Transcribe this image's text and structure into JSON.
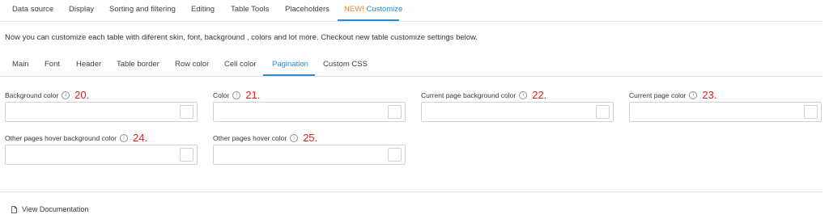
{
  "top_tabs": {
    "data_source": "Data source",
    "display": "Display",
    "sorting": "Sorting and filtering",
    "editing": "Editing",
    "table_tools": "Table Tools",
    "placeholders": "Placeholders",
    "customize_new": "NEW!",
    "customize": "Customize"
  },
  "intro_text": "Now you can customize each table with diferent skin, font, background , colors and lot more. Checkout new table customize settings below.",
  "sub_tabs": {
    "main": "Main",
    "font": "Font",
    "header": "Header",
    "table_border": "Table border",
    "row_color": "Row color",
    "cell_color": "Cell color",
    "pagination": "Pagination",
    "custom_css": "Custom CSS"
  },
  "fields": {
    "background_color": {
      "label": "Background color",
      "callout": "20.",
      "value": ""
    },
    "color": {
      "label": "Color",
      "callout": "21.",
      "value": ""
    },
    "current_page_background_color": {
      "label": "Current page background color",
      "callout": "22.",
      "value": ""
    },
    "current_page_color": {
      "label": "Current page color",
      "callout": "23.",
      "value": ""
    },
    "other_pages_hover_background_color": {
      "label": "Other pages hover background color",
      "callout": "24.",
      "value": ""
    },
    "other_pages_hover_color": {
      "label": "Other pages hover color",
      "callout": "25.",
      "value": ""
    }
  },
  "info_glyph": "i",
  "documentation_link": "View Documentation",
  "colors": {
    "accent": "#2a8ad4",
    "new_badge": "#e8833a",
    "callout": "#e02020"
  },
  "icons": {
    "info": "info-circle-icon",
    "document": "document-icon",
    "color_swatch": "color-swatch"
  }
}
